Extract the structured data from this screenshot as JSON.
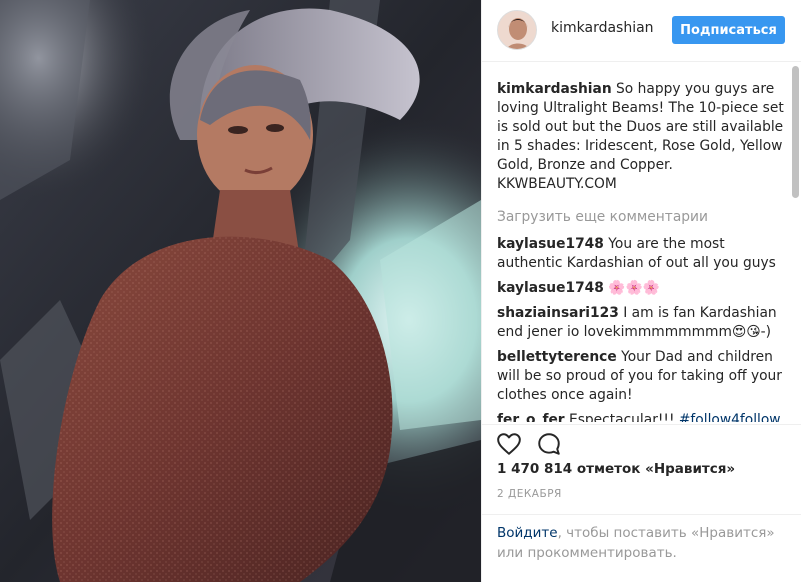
{
  "header": {
    "username": "kimkardashian",
    "follow_label": "Подписаться"
  },
  "caption": {
    "username": "kimkardashian",
    "text": "So happy you guys are loving Ultralight Beams! The 10-piece set is sold out but the Duos are still available in 5 shades: Iridescent, Rose Gold, Yellow Gold, Bronze and Copper. KKWBEAUTY.COM"
  },
  "load_more": "Загрузить еще комментарии",
  "comments": [
    {
      "username": "kaylasue1748",
      "text": "You are the most authentic Kardashian of out all you guys"
    },
    {
      "username": "kaylasue1748",
      "text": "🌸🌸🌸"
    },
    {
      "username": "shaziainsari123",
      "text": "I am is fan Kardashian end jener io lovekimmmmmmmm😍😘-)"
    },
    {
      "username": "bellettyterence",
      "text": "Your Dad and children will be so proud of you for taking off your clothes once again!"
    },
    {
      "username": "fer_o_fer",
      "text": "Espectacular!!! ",
      "hashtag": "#follow4follow",
      "more": "llow"
    }
  ],
  "likes": "1 470 814 отметок «Нравится»",
  "date": "2 ДЕКАБРЯ",
  "login": {
    "link": "Войдите",
    "rest": ", чтобы поставить «Нравится» или прокомментировать."
  },
  "colors": {
    "accent": "#3897f0",
    "link": "#003569",
    "muted": "#999999"
  },
  "icons": [
    "heart-icon",
    "comment-icon"
  ]
}
